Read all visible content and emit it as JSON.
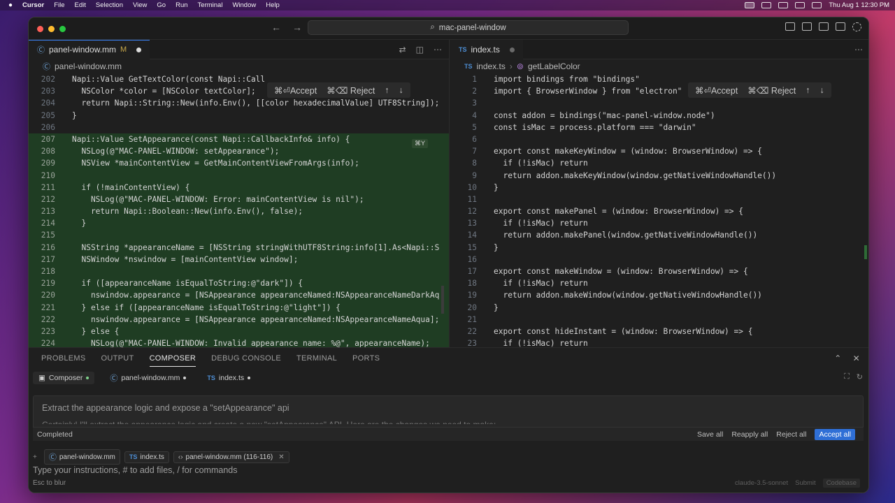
{
  "menubar": {
    "app": "Cursor",
    "items": [
      "File",
      "Edit",
      "Selection",
      "View",
      "Go",
      "Run",
      "Terminal",
      "Window",
      "Help"
    ],
    "datetime": "Thu Aug 1  12:30 PM"
  },
  "titlebar": {
    "search": "mac-panel-window"
  },
  "left_editor": {
    "tab": {
      "label": "panel-window.mm",
      "modified": "M"
    },
    "breadcrumb": "panel-window.mm",
    "overlay": {
      "accept": "⌘⏎Accept",
      "reject": "⌘⌫ Reject"
    },
    "badge": "⌘Y",
    "lines": [
      {
        "n": "202",
        "t": "Napi::Value GetTextColor(const Napi::Call",
        "added": false
      },
      {
        "n": "203",
        "t": "  NSColor *color = [NSColor textColor];",
        "added": false
      },
      {
        "n": "204",
        "t": "  return Napi::String::New(info.Env(), [[color hexadecimalValue] UTF8String]);",
        "added": false
      },
      {
        "n": "205",
        "t": "}",
        "added": false
      },
      {
        "n": "206",
        "t": "",
        "added": false
      },
      {
        "n": "207",
        "t": "Napi::Value SetAppearance(const Napi::CallbackInfo& info) {",
        "added": true
      },
      {
        "n": "208",
        "t": "  NSLog(@\"MAC-PANEL-WINDOW: setAppearance\");",
        "added": true
      },
      {
        "n": "209",
        "t": "  NSView *mainContentView = GetMainContentViewFromArgs(info);",
        "added": true
      },
      {
        "n": "210",
        "t": "",
        "added": true
      },
      {
        "n": "211",
        "t": "  if (!mainContentView) {",
        "added": true
      },
      {
        "n": "212",
        "t": "    NSLog(@\"MAC-PANEL-WINDOW: Error: mainContentView is nil\");",
        "added": true
      },
      {
        "n": "213",
        "t": "    return Napi::Boolean::New(info.Env(), false);",
        "added": true
      },
      {
        "n": "214",
        "t": "  }",
        "added": true
      },
      {
        "n": "215",
        "t": "",
        "added": true
      },
      {
        "n": "216",
        "t": "  NSString *appearanceName = [NSString stringWithUTF8String:info[1].As<Napi::S",
        "added": true
      },
      {
        "n": "217",
        "t": "  NSWindow *nswindow = [mainContentView window];",
        "added": true
      },
      {
        "n": "218",
        "t": "",
        "added": true
      },
      {
        "n": "219",
        "t": "  if ([appearanceName isEqualToString:@\"dark\"]) {",
        "added": true
      },
      {
        "n": "220",
        "t": "    nswindow.appearance = [NSAppearance appearanceNamed:NSAppearanceNameDarkAq",
        "added": true
      },
      {
        "n": "221",
        "t": "  } else if ([appearanceName isEqualToString:@\"light\"]) {",
        "added": true
      },
      {
        "n": "222",
        "t": "    nswindow.appearance = [NSAppearance appearanceNamed:NSAppearanceNameAqua];",
        "added": true
      },
      {
        "n": "223",
        "t": "  } else {",
        "added": true
      },
      {
        "n": "224",
        "t": "    NSLog(@\"MAC-PANEL-WINDOW: Invalid appearance name: %@\", appearanceName);",
        "added": true
      }
    ]
  },
  "right_editor": {
    "tab": {
      "prefix": "TS",
      "label": "index.ts"
    },
    "breadcrumb": {
      "file": "index.ts",
      "symbol": "getLabelColor"
    },
    "overlay": {
      "accept": "⌘⏎Accept",
      "reject": "⌘⌫ Reject"
    },
    "lines": [
      {
        "n": "1",
        "t": "import bindings from \"bindings\""
      },
      {
        "n": "2",
        "t": "import { BrowserWindow } from \"electron\""
      },
      {
        "n": "3",
        "t": ""
      },
      {
        "n": "4",
        "t": "const addon = bindings(\"mac-panel-window.node\")"
      },
      {
        "n": "5",
        "t": "const isMac = process.platform === \"darwin\""
      },
      {
        "n": "6",
        "t": ""
      },
      {
        "n": "7",
        "t": "export const makeKeyWindow = (window: BrowserWindow) => {"
      },
      {
        "n": "8",
        "t": "  if (!isMac) return"
      },
      {
        "n": "9",
        "t": "  return addon.makeKeyWindow(window.getNativeWindowHandle())"
      },
      {
        "n": "10",
        "t": "}"
      },
      {
        "n": "11",
        "t": ""
      },
      {
        "n": "12",
        "t": "export const makePanel = (window: BrowserWindow) => {"
      },
      {
        "n": "13",
        "t": "  if (!isMac) return"
      },
      {
        "n": "14",
        "t": "  return addon.makePanel(window.getNativeWindowHandle())"
      },
      {
        "n": "15",
        "t": "}"
      },
      {
        "n": "16",
        "t": ""
      },
      {
        "n": "17",
        "t": "export const makeWindow = (window: BrowserWindow) => {"
      },
      {
        "n": "18",
        "t": "  if (!isMac) return"
      },
      {
        "n": "19",
        "t": "  return addon.makeWindow(window.getNativeWindowHandle())"
      },
      {
        "n": "20",
        "t": "}"
      },
      {
        "n": "21",
        "t": ""
      },
      {
        "n": "22",
        "t": "export const hideInstant = (window: BrowserWindow) => {"
      },
      {
        "n": "23",
        "t": "  if (!isMac) return"
      }
    ]
  },
  "panel": {
    "tabs": [
      "PROBLEMS",
      "OUTPUT",
      "COMPOSER",
      "DEBUG CONSOLE",
      "TERMINAL",
      "PORTS"
    ],
    "active_tab": "COMPOSER",
    "composer_tabs": [
      "Composer",
      "panel-window.mm",
      "index.ts"
    ],
    "prompt": "Extract the appearance logic and expose a \"setAppearance\" api",
    "response_snippet": "Certainly! I'll extract the appearance logic and create a new \"setAppearance\" API. Here are the changes we need to make:",
    "status": "Completed",
    "actions": {
      "save_all": "Save all",
      "reapply_all": "Reapply all",
      "reject_all": "Reject all",
      "accept_all": "Accept all"
    },
    "chips": [
      "panel-window.mm",
      "index.ts",
      "panel-window.mm (116-116)"
    ],
    "input_placeholder": "Type your instructions, # to add files, / for commands",
    "esc_hint": "Esc to blur",
    "model": "claude-3.5-sonnet",
    "submit": "Submit",
    "codebase": "Codebase"
  }
}
